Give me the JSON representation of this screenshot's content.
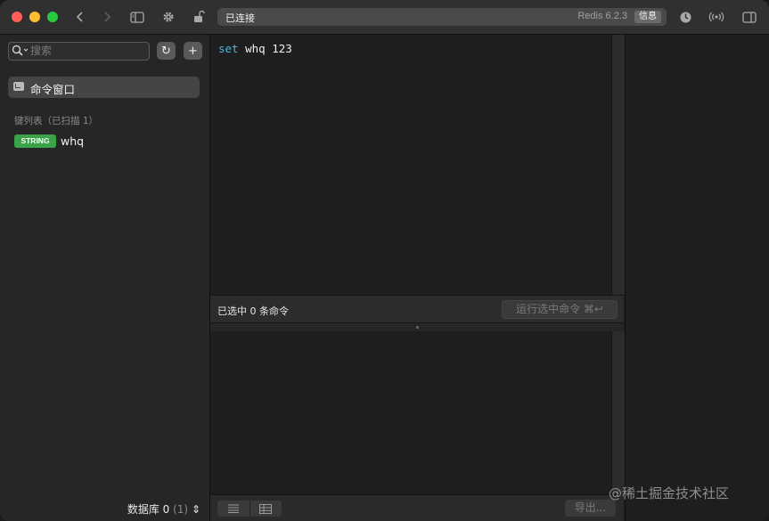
{
  "titlebar": {
    "status": "已连接",
    "version": "Redis 6.2.3",
    "info_button": "信息"
  },
  "sidebar": {
    "search_placeholder": "搜索",
    "refresh_icon": "↻",
    "add_icon": "+",
    "command_window": "命令窗口",
    "key_list_header": "键列表（已扫描 1）",
    "keys": [
      {
        "type": "STRING",
        "name": "whq"
      }
    ],
    "database_label": "数据库 0",
    "database_count": "(1)",
    "database_stepper": "⇕"
  },
  "editor": {
    "command_keyword": "set",
    "command_args": " whq 123"
  },
  "command_bar": {
    "selected_text": "已选中 0 条命令",
    "run_button": "运行选中命令 ⌘↩"
  },
  "bottom_bar": {
    "export_button": "导出..."
  },
  "watermark": "@稀土掘金技术社区",
  "colors": {
    "accent_string": "#3aa348",
    "keyword": "#4fb5d8"
  }
}
